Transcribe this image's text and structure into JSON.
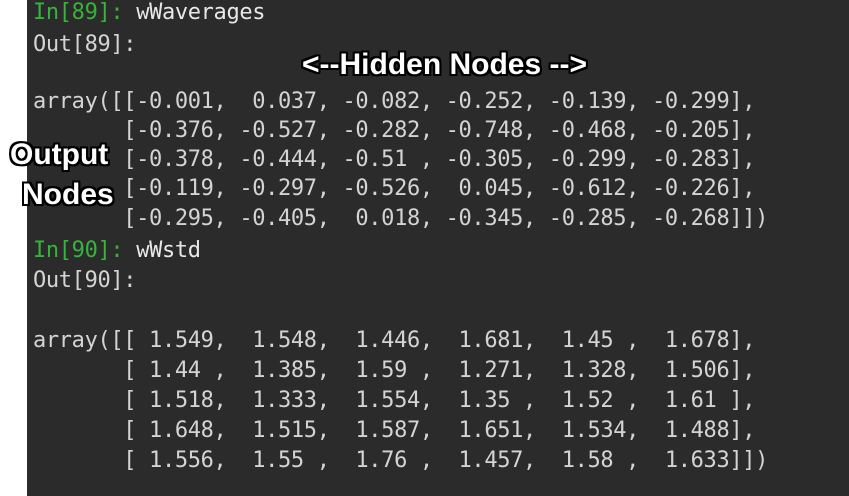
{
  "cell1": {
    "in_prompt": "In[89]:",
    "command": "wWaverages",
    "out_prompt": "Out[89]:",
    "rows": [
      "array([[-0.001,  0.037, -0.082, -0.252, -0.139, -0.299],",
      "       [-0.376, -0.527, -0.282, -0.748, -0.468, -0.205],",
      "       [-0.378, -0.444, -0.51 , -0.305, -0.299, -0.283],",
      "       [-0.119, -0.297, -0.526,  0.045, -0.612, -0.226],",
      "       [-0.295, -0.405,  0.018, -0.345, -0.285, -0.268]])"
    ]
  },
  "cell2": {
    "in_prompt": "In[90]:",
    "command": "wWstd",
    "out_prompt": "Out[90]:",
    "rows": [
      "array([[ 1.549,  1.548,  1.446,  1.681,  1.45 ,  1.678],",
      "       [ 1.44 ,  1.385,  1.59 ,  1.271,  1.328,  1.506],",
      "       [ 1.518,  1.333,  1.554,  1.35 ,  1.52 ,  1.61 ],",
      "       [ 1.648,  1.515,  1.587,  1.651,  1.534,  1.488],",
      "       [ 1.556,  1.55 ,  1.76 ,  1.457,  1.58 ,  1.633]])"
    ]
  },
  "annotations": {
    "hidden_nodes": "<--Hidden Nodes -->",
    "output_line1": "Output",
    "output_line2": "Nodes"
  },
  "colors": {
    "terminal_bg": "#2b2b2b",
    "prompt_green": "#36b33a",
    "text": "#d4d4d4"
  }
}
